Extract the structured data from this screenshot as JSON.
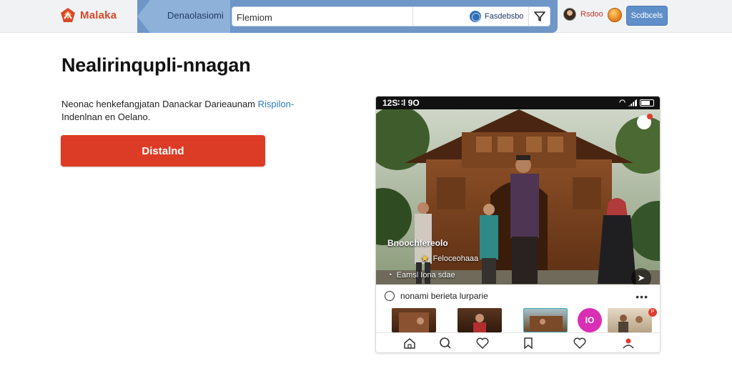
{
  "header": {
    "brand": "Malaka",
    "band_label": "Denaolasiomi",
    "search": {
      "value": "",
      "placeholder": "Flemiom"
    },
    "scope_label": "Fasdebsbo",
    "profile_name": "Rsdoo",
    "action_label": "Scdbcels"
  },
  "main": {
    "title": "Nealirinqupli-nnagan",
    "description_lead": "Neonac henkefangjatan Danackar Darieaunam ",
    "description_link": "Rispilon-",
    "description_tail": "Indenlnan en Oelano.",
    "cta_label": "Distalnd"
  },
  "phone": {
    "status_time": "12S∷l 9O",
    "overlay_name": "Bnoochfereolo",
    "overlay_location": "Feloceohaaa",
    "overlay_meta": "Eamsl Iona sdae",
    "caption": "nonami berieta lurparie",
    "more_label": "•••",
    "thumb_badge_label": "IO",
    "thumb_corner_label": "P"
  },
  "icons": {
    "logo": "malaka-logo-icon",
    "globe": "globe-icon",
    "filter": "filter-icon",
    "star": "star-icon",
    "share": "share-icon",
    "nav": [
      "home-icon",
      "search-icon",
      "heart-icon",
      "bookmark-icon",
      "heart-icon",
      "profile-pin-icon"
    ]
  },
  "colors": {
    "brand": "#d8482a",
    "cta": "#dc3b25",
    "band": "#6e97c8",
    "link": "#2a7bbf",
    "accent_pink": "#d92fb4"
  }
}
